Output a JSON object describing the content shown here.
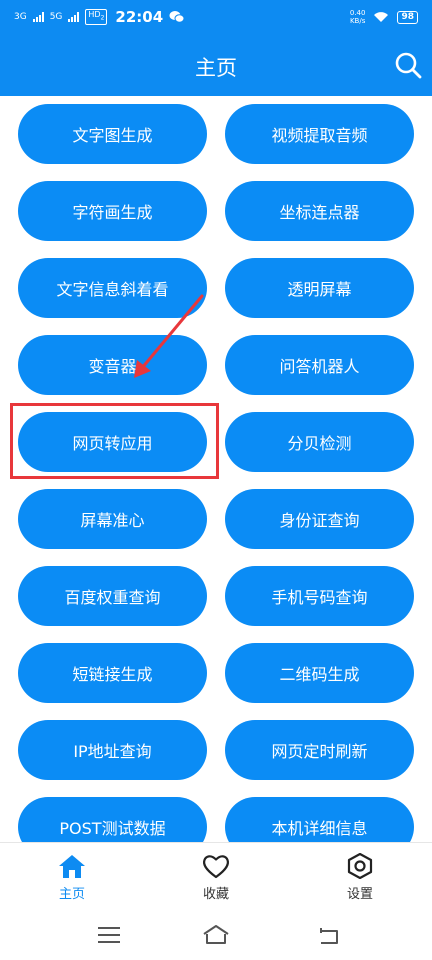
{
  "status_bar": {
    "network1": "3G",
    "network2": "5G",
    "hd": "HD",
    "hd_sub": "2",
    "time": "22:04",
    "speed_value": "0.40",
    "speed_unit": "KB/s",
    "battery": "98"
  },
  "header": {
    "title": "主页"
  },
  "tools": [
    {
      "label": "文字图生成"
    },
    {
      "label": "视频提取音频"
    },
    {
      "label": "字符画生成"
    },
    {
      "label": "坐标连点器"
    },
    {
      "label": "文字信息斜着看"
    },
    {
      "label": "透明屏幕"
    },
    {
      "label": "变音器"
    },
    {
      "label": "问答机器人"
    },
    {
      "label": "网页转应用"
    },
    {
      "label": "分贝检测"
    },
    {
      "label": "屏幕准心"
    },
    {
      "label": "身份证查询"
    },
    {
      "label": "百度权重查询"
    },
    {
      "label": "手机号码查询"
    },
    {
      "label": "短链接生成"
    },
    {
      "label": "二维码生成"
    },
    {
      "label": "IP地址查询"
    },
    {
      "label": "网页定时刷新"
    },
    {
      "label": "POST测试数据"
    },
    {
      "label": "本机详细信息"
    }
  ],
  "bottom_nav": [
    {
      "label": "主页",
      "icon": "home-icon",
      "active": true
    },
    {
      "label": "收藏",
      "icon": "heart-icon",
      "active": false
    },
    {
      "label": "设置",
      "icon": "hexagon-gear-icon",
      "active": false
    }
  ],
  "colors": {
    "primary": "#0d8bf2",
    "button": "#0b8cf5",
    "annotation": "#e8373b"
  }
}
